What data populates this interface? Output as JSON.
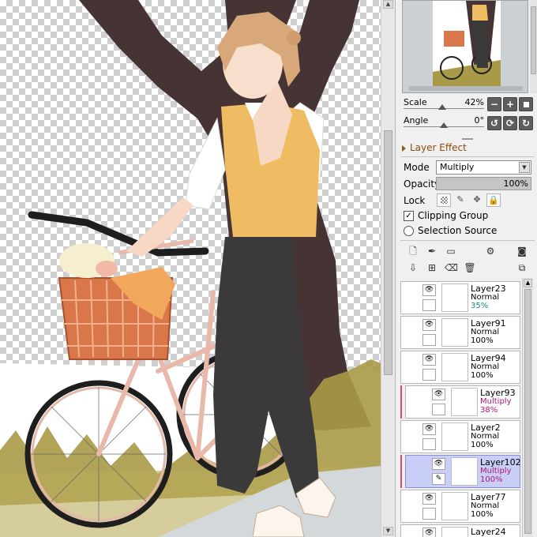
{
  "navigator": {
    "scale_label": "Scale",
    "scale_value": "42%",
    "angle_label": "Angle",
    "angle_value": "0°"
  },
  "nav_buttons": {
    "minus": "−",
    "plus": "+",
    "rotate_left": "↺",
    "reset": "⟳",
    "rotate_right": "↻"
  },
  "layer_effect": {
    "title": "Layer Effect",
    "mode_label": "Mode",
    "mode_value": "Multiply",
    "opacity_label": "Opacity",
    "opacity_value": "100%",
    "opacity_fraction": 1.0,
    "lock_label": "Lock",
    "clipping_group_label": "Clipping Group",
    "clipping_group_checked": true,
    "selection_source_label": "Selection Source",
    "selection_source_checked": false
  },
  "layers": [
    {
      "name": "Layer23",
      "mode": "Normal",
      "opacity": "35%",
      "clipped": false,
      "selected": false,
      "visible": true
    },
    {
      "name": "Layer91",
      "mode": "Normal",
      "opacity": "100%",
      "clipped": false,
      "selected": false,
      "visible": true
    },
    {
      "name": "Layer94",
      "mode": "Normal",
      "opacity": "100%",
      "clipped": false,
      "selected": false,
      "visible": true
    },
    {
      "name": "Layer93",
      "mode": "Multiply",
      "opacity": "38%",
      "clipped": true,
      "selected": false,
      "visible": true
    },
    {
      "name": "Layer2",
      "mode": "Normal",
      "opacity": "100%",
      "clipped": false,
      "selected": false,
      "visible": true
    },
    {
      "name": "Layer102",
      "mode": "Multiply",
      "opacity": "100%",
      "clipped": true,
      "selected": true,
      "visible": true
    },
    {
      "name": "Layer77",
      "mode": "Normal",
      "opacity": "100%",
      "clipped": false,
      "selected": false,
      "visible": true
    },
    {
      "name": "Layer24",
      "mode": "",
      "opacity": "",
      "clipped": false,
      "selected": false,
      "visible": true
    }
  ],
  "glyphs": {
    "eye": "👁",
    "check": "✓",
    "up": "▲",
    "down": "▼",
    "brush": "✎"
  },
  "colors": {
    "accent_clip": "#e0457a",
    "selected_layer": "#c9cef7",
    "section_title": "#8a4a12",
    "opacity_teal": "#1a8a7a",
    "multiply_purple": "#b0157a"
  }
}
